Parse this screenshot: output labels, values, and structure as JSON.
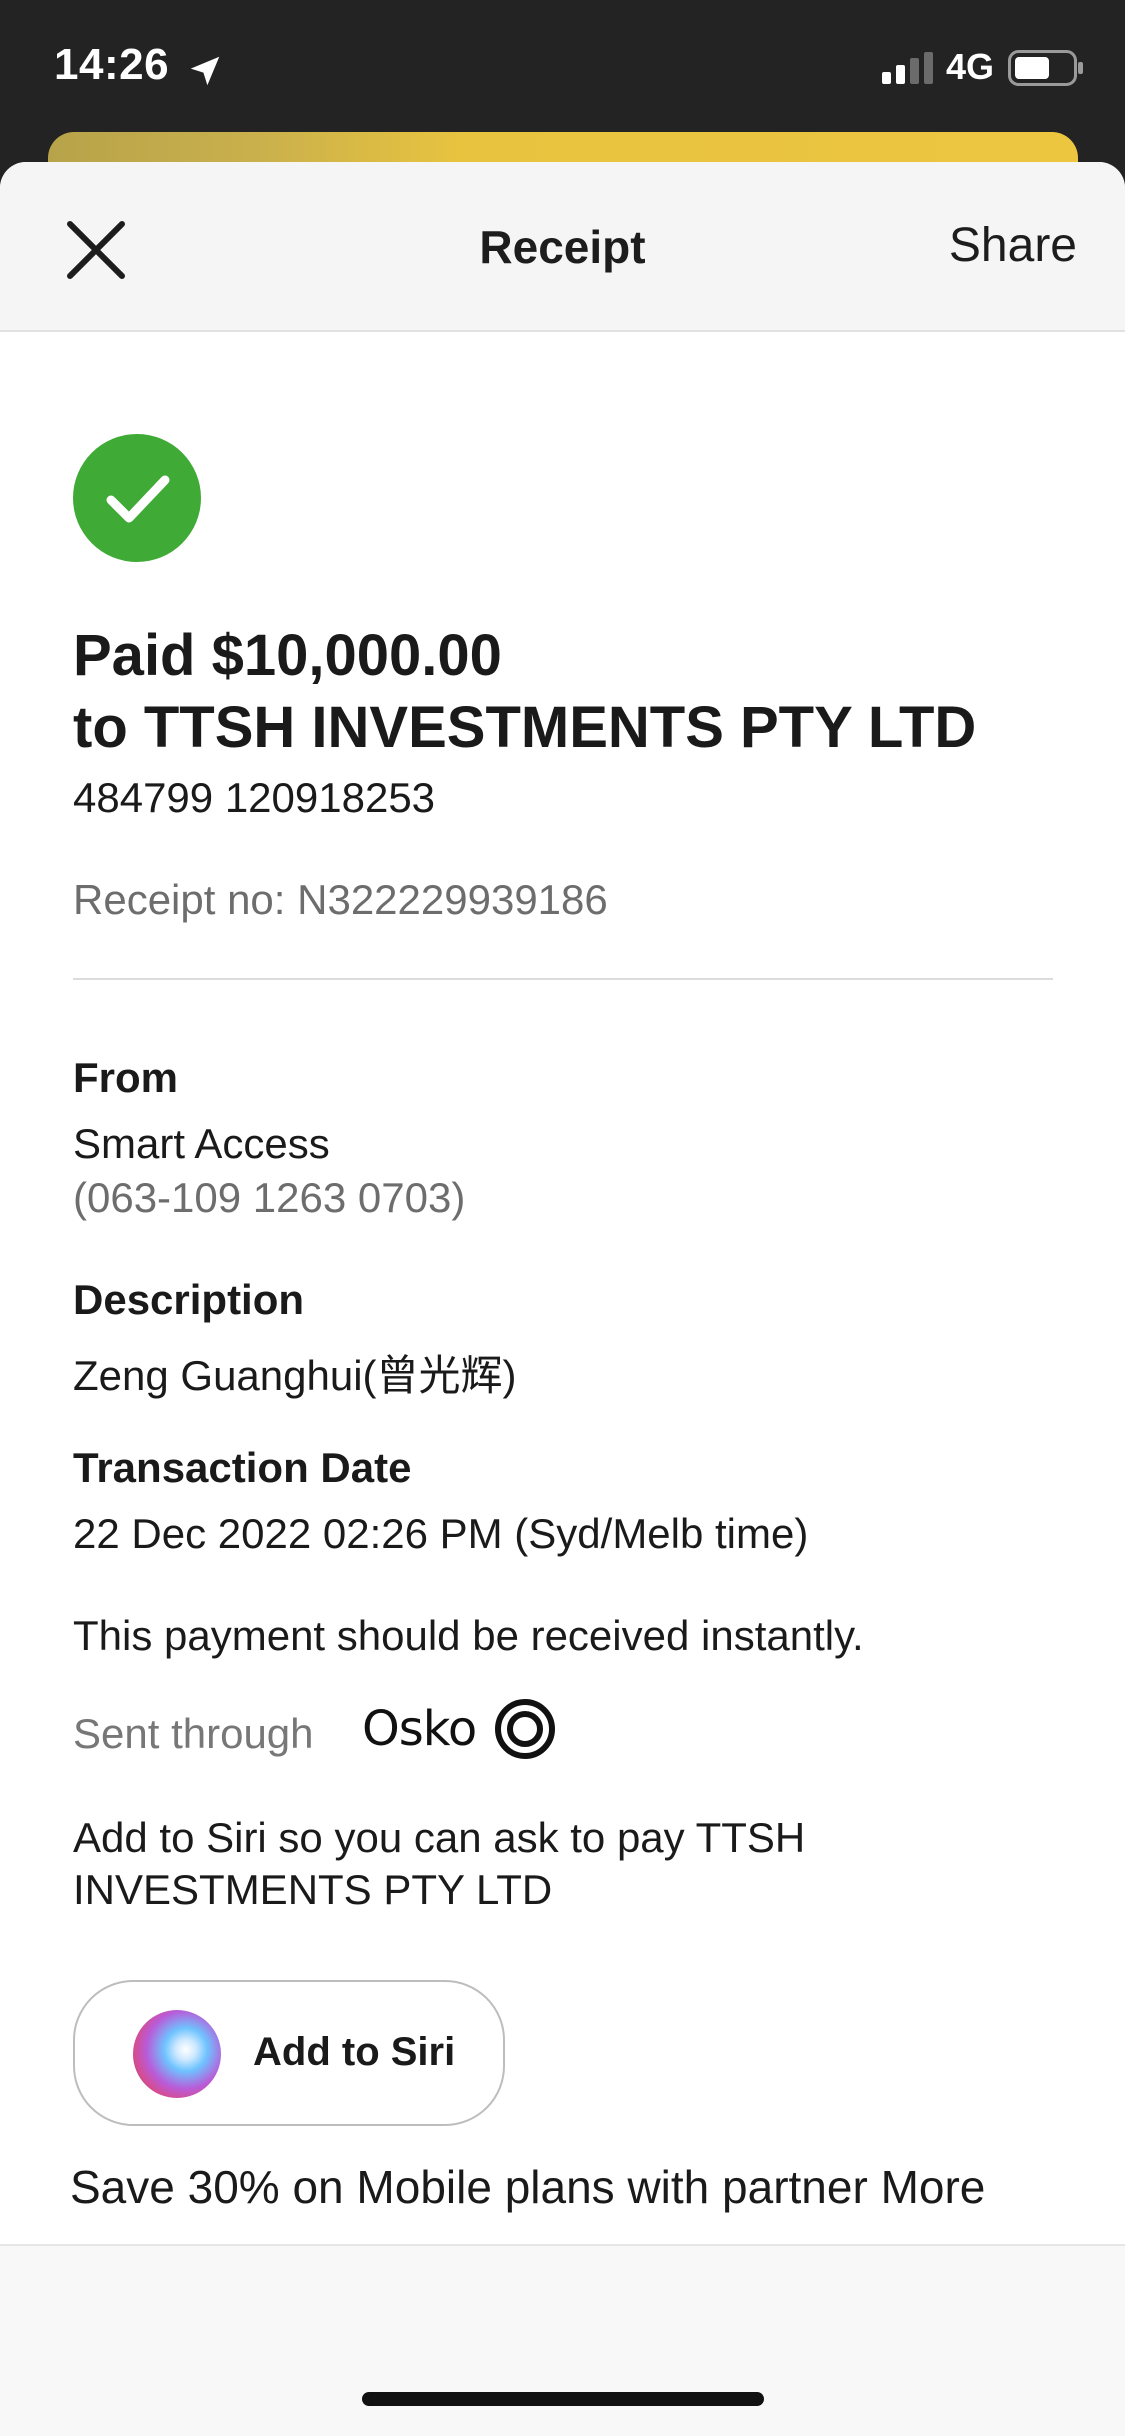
{
  "status_bar": {
    "time": "14:26",
    "network": "4G"
  },
  "header": {
    "title": "Receipt",
    "share_label": "Share"
  },
  "payment": {
    "paid_line1": "Paid $10,000.00",
    "paid_line2": "to TTSH INVESTMENTS PTY LTD",
    "account_numbers": "484799 120918253",
    "receipt_no": "Receipt no: N322229939186"
  },
  "details": {
    "from_label": "From",
    "from_value": "Smart Access",
    "from_account": "(063-109 1263 0703)",
    "description_label": "Description",
    "description_value": "Zeng Guanghui(曾光辉)",
    "date_label": "Transaction Date",
    "date_value": "22 Dec 2022 02:26 PM (Syd/Melb time)",
    "instant_note": "This payment should be received instantly.",
    "sent_through_label": "Sent through",
    "osko_label": "Osko"
  },
  "siri": {
    "prompt": "Add to Siri so you can ask to pay TTSH INVESTMENTS PTY LTD",
    "button_label": "Add to Siri"
  },
  "promo": {
    "text": "Save 30% on Mobile plans with partner More"
  },
  "icons": {
    "close": "close-icon",
    "success": "checkmark-circle-icon",
    "location": "location-arrow-icon",
    "signal": "cellular-signal-icon",
    "battery": "battery-icon",
    "osko": "osko-logo-icon",
    "siri": "siri-orb-icon"
  },
  "colors": {
    "success_green": "#3faa35",
    "status_bar_bg": "#232323",
    "peek_card_gold": "#edc640",
    "header_bg": "#f5f5f5",
    "muted_text": "#6d6d6d"
  }
}
